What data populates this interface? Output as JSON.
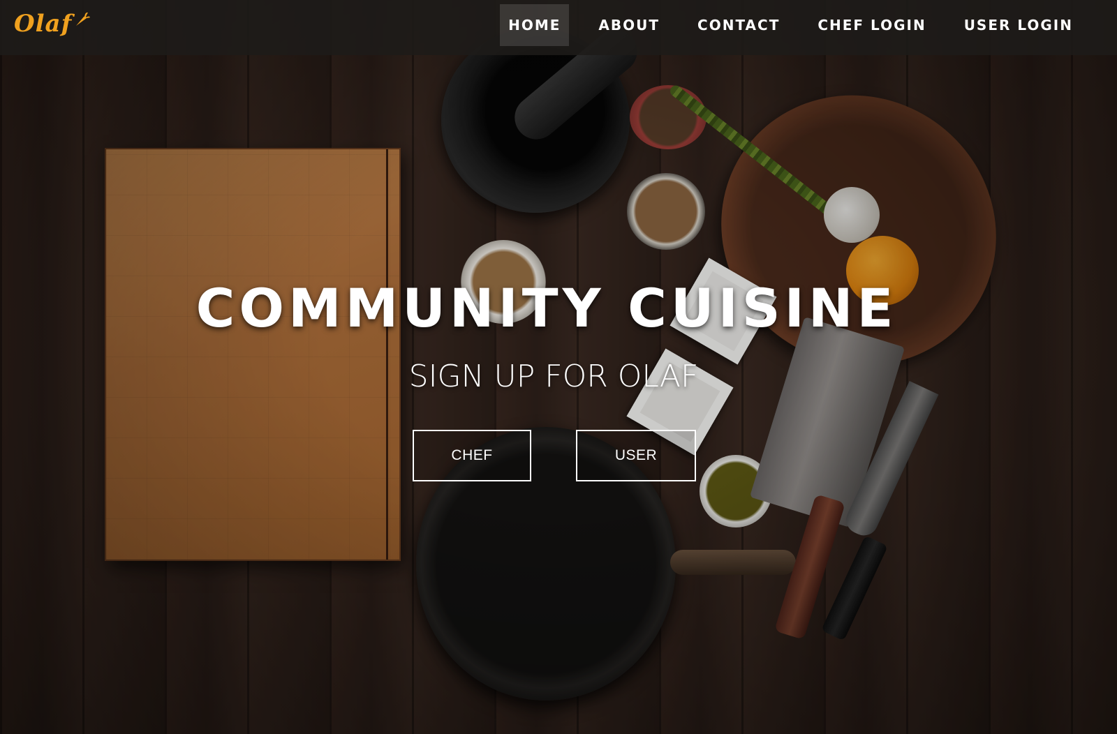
{
  "brand": {
    "name": "Olaf",
    "color": "#f0a11f",
    "icon": "carrot-icon"
  },
  "nav": {
    "items": [
      {
        "label": "HOME",
        "active": true
      },
      {
        "label": "ABOUT",
        "active": false
      },
      {
        "label": "CONTACT",
        "active": false
      },
      {
        "label": "CHEF LOGIN",
        "active": false
      },
      {
        "label": "USER LOGIN",
        "active": false
      }
    ]
  },
  "hero": {
    "title": "COMMUNITY CUISINE",
    "subtitle": "SIGN UP FOR OLAF",
    "buttons": [
      {
        "label": "CHEF"
      },
      {
        "label": "USER"
      }
    ]
  },
  "colors": {
    "navbar_bg": "#1e1b19",
    "text": "#ffffff",
    "accent": "#f0a11f"
  }
}
